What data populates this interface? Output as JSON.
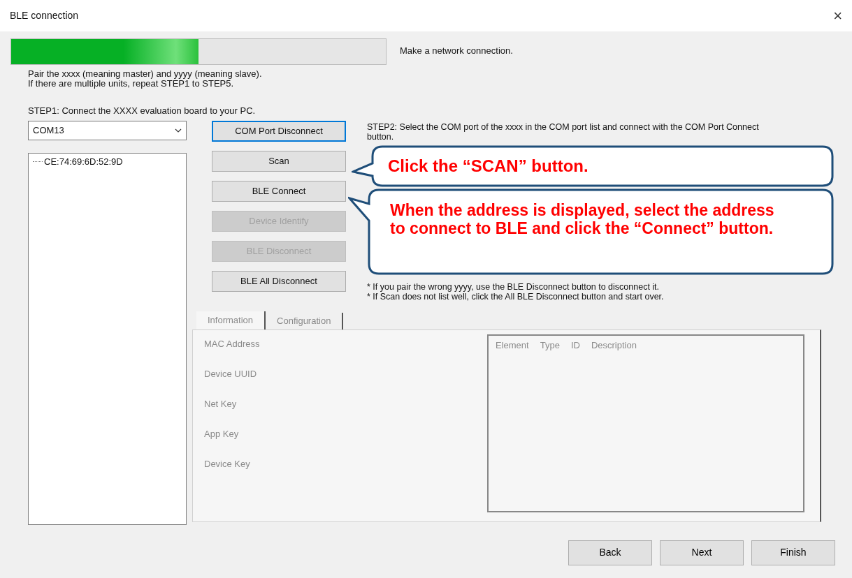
{
  "window": {
    "title": "BLE connection",
    "close": "×"
  },
  "progress": {
    "level": 0.5,
    "label": "Make a network connection."
  },
  "intro": [
    "Pair the xxxx (meaning master) and yyyy (meaning slave).",
    "If there are multiple units, repeat STEP1 to STEP5."
  ],
  "step1": "STEP1: Connect the XXXX evaluation board to your PC.",
  "com_port": {
    "value": "COM13"
  },
  "devices": [
    {
      "label": "CE:74:69:6D:52:9D",
      "selected": false
    }
  ],
  "buttons": [
    {
      "label": "COM Port Disconnect",
      "disabled": false,
      "focused": true
    },
    {
      "label": "Scan",
      "disabled": false,
      "focused": false
    },
    {
      "label": "BLE Connect",
      "disabled": false,
      "focused": false
    },
    {
      "label": "Device Identify",
      "disabled": true,
      "focused": false
    },
    {
      "label": "BLE Disconnect",
      "disabled": true,
      "focused": false
    },
    {
      "label": "BLE All Disconnect",
      "disabled": false,
      "focused": false
    }
  ],
  "step2": "STEP2: Select the COM port of the xxxx in the COM port list and connect with the COM Port Connect button.",
  "notes": [
    "* If you pair the wrong yyyy, use the BLE Disconnect button to disconnect it.",
    "* If Scan does not list well, click the All BLE Disconnect button and start over."
  ],
  "tabs": [
    {
      "label": "Information",
      "selected": true
    },
    {
      "label": "Configuration",
      "selected": false
    }
  ],
  "info_fields": [
    "MAC Address",
    "Device UUID",
    "Net Key",
    "App Key",
    "Device Key"
  ],
  "element_list": {
    "columns": [
      "Element",
      "Type",
      "ID",
      "Description"
    ]
  },
  "footer_buttons": [
    "Back",
    "Next",
    "Finish"
  ],
  "callouts": [
    {
      "text": "Click the “SCAN” button."
    },
    {
      "text": "When the address is displayed, select the address to connect to BLE and click the “Connect” button."
    }
  ]
}
